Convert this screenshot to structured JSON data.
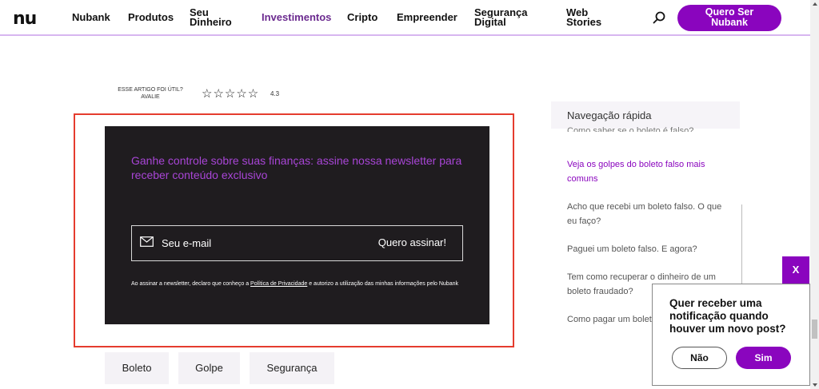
{
  "header": {
    "logo": "nu",
    "nav": [
      {
        "label": "Nubank"
      },
      {
        "label": "Produtos"
      },
      {
        "label": "Seu Dinheiro",
        "line1": "Seu",
        "line2": "Dinheiro"
      },
      {
        "label": "Investimentos"
      },
      {
        "label": "Cripto"
      },
      {
        "label": "Empreender"
      },
      {
        "label": "Segurança Digital",
        "line1": "Segurança",
        "line2": "Digital"
      },
      {
        "label": "Web Stories",
        "line1": "Web",
        "line2": "Stories"
      }
    ],
    "search_icon": "search-icon",
    "cta": {
      "line1": "Quero Ser",
      "line2": "Nubank"
    }
  },
  "rating": {
    "question": "ESSE ARTIGO FOI ÚTIL?",
    "action": "AVALIE",
    "stars": "☆☆☆☆☆",
    "value": "4.3"
  },
  "newsletter": {
    "title": "Ganhe controle sobre suas finanças: assine nossa newsletter para receber conteúdo exclusivo",
    "mail_icon": "mail-icon",
    "input_placeholder": "Seu e-mail",
    "submit_label": "Quero assinar!",
    "legal_before": "Ao assinar a newsletter, declaro que conheço a ",
    "legal_link": "Política de Privacidade",
    "legal_after": " e autorizo a utilização das minhas informações pelo Nubank"
  },
  "tags": [
    "Boleto",
    "Golpe",
    "Segurança"
  ],
  "sidebar": {
    "title": "Navegação rápida",
    "cut_item": "Como saber se o boleto é falso?",
    "items": [
      {
        "label": "Veja os golpes do boleto falso mais comuns"
      },
      {
        "label": "Acho que recebi um boleto falso. O que eu faço?"
      },
      {
        "label": "Paguei um boleto falso. E agora?"
      },
      {
        "label": "Tem como recuperar o dinheiro de um boleto fraudado?"
      },
      {
        "label": "Como pagar um boleto"
      }
    ]
  },
  "notification": {
    "close_label": "X",
    "question": "Quer receber uma notificação quando houver um novo post?",
    "no_label": "Não",
    "yes_label": "Sim"
  },
  "colors": {
    "brand": "#8a05be",
    "newsletter_bg": "#1f1c1f",
    "newsletter_title": "#a845d6",
    "highlight": "#e53c2e"
  }
}
